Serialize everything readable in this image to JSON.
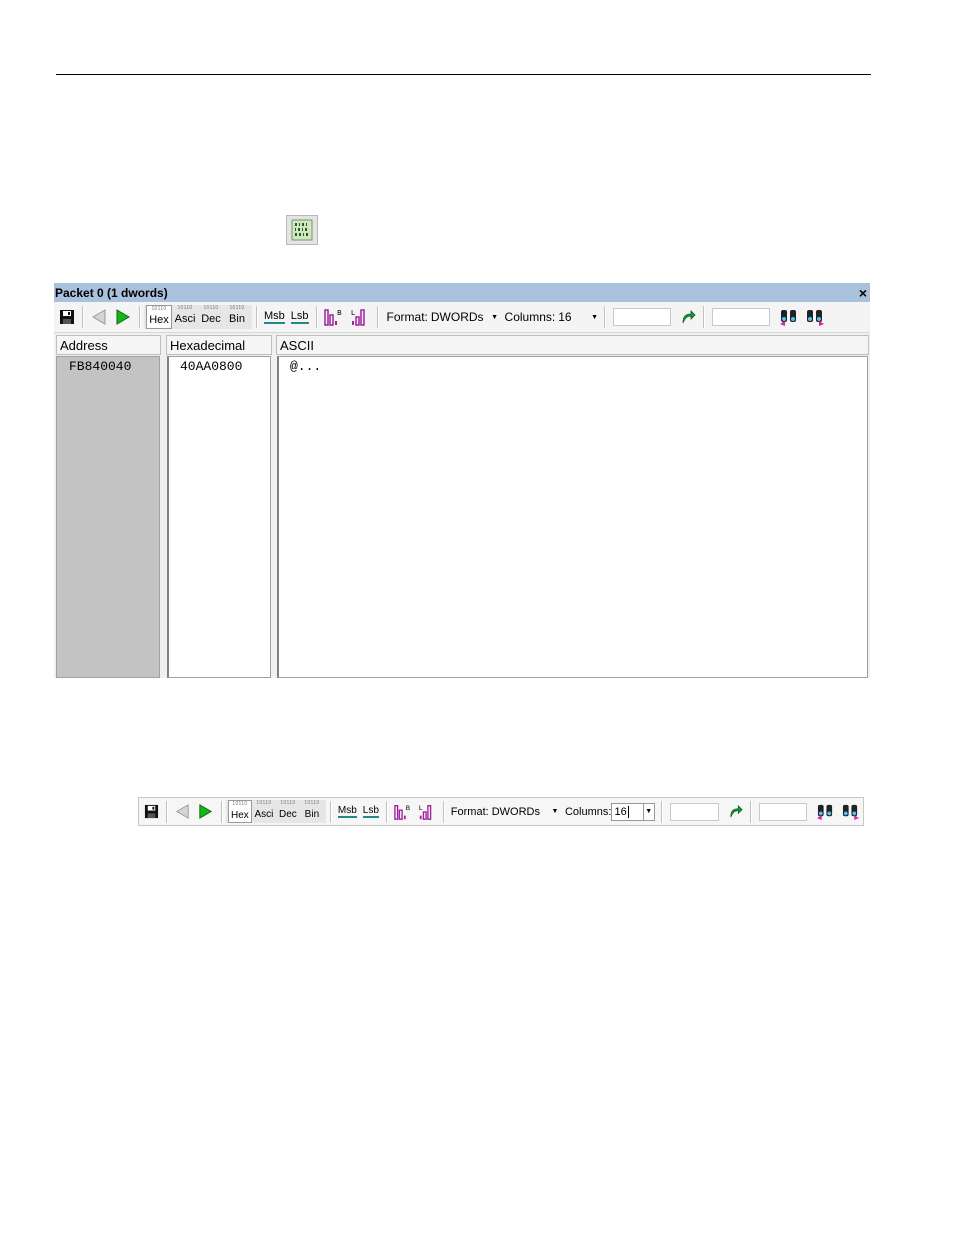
{
  "window": {
    "title": "Packet 0 (1 dwords)",
    "close_label": "×"
  },
  "toolbar": {
    "format_buttons": [
      {
        "bits": "10110",
        "label": "Hex"
      },
      {
        "bits": "10110",
        "label": "Asci"
      },
      {
        "bits": "10110",
        "label": "Dec"
      },
      {
        "bits": "10110",
        "label": "Bin"
      }
    ],
    "msb_label": "Msb",
    "lsb_label": "Lsb",
    "format_label": "Format:",
    "format_value": "DWORDs",
    "columns_label": "Columns:",
    "columns_value": "16"
  },
  "columns": {
    "address": "Address",
    "hexadecimal": "Hexadecimal",
    "ascii": "ASCII"
  },
  "rows": [
    {
      "address": "FB840040",
      "hex": "40AA0800",
      "ascii": "@..."
    }
  ],
  "colors": {
    "title_bar": "#a9c1dc",
    "address_pane": "#c3c3c3",
    "play_green": "#19b419",
    "bit_purple": "#a020a0"
  },
  "icons": [
    "save-icon",
    "back-arrow-icon",
    "forward-arrow-icon",
    "msb-icon",
    "lsb-icon",
    "bit-order-icon",
    "byte-order-icon",
    "goto-arrow-icon",
    "find-prev-icon",
    "find-next-icon"
  ]
}
